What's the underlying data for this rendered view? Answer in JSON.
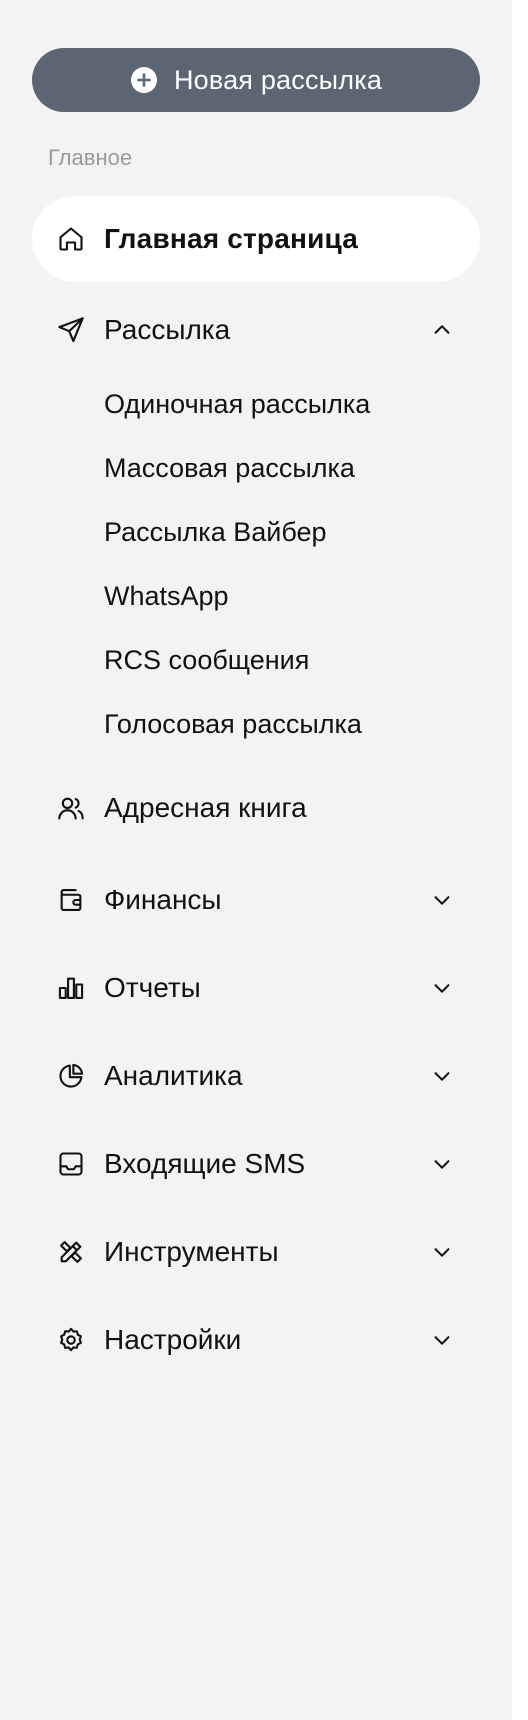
{
  "new_mailing_button": {
    "label": "Новая рассылка",
    "icon": "plus-circle-icon"
  },
  "section_label": "Главное",
  "nav": {
    "home": {
      "label": "Главная страница",
      "icon": "home-icon"
    },
    "mailing": {
      "label": "Рассылка",
      "icon": "send-icon",
      "expanded": true,
      "sub_items": [
        "Одиночная рассылка",
        "Массовая рассылка",
        "Рассылка Вайбер",
        "WhatsApp",
        "RCS сообщения",
        "Голосовая рассылка"
      ]
    },
    "address_book": {
      "label": "Адресная книга",
      "icon": "users-icon"
    },
    "finance": {
      "label": "Финансы",
      "icon": "wallet-icon"
    },
    "reports": {
      "label": "Отчеты",
      "icon": "bar-chart-icon"
    },
    "analytics": {
      "label": "Аналитика",
      "icon": "pie-chart-icon"
    },
    "incoming_sms": {
      "label": "Входящие SMS",
      "icon": "inbox-icon"
    },
    "tools": {
      "label": "Инструменты",
      "icon": "tools-icon"
    },
    "settings": {
      "label": "Настройки",
      "icon": "gear-icon"
    }
  },
  "colors": {
    "sidebar_bg": "#f3f3f3",
    "button_bg": "#5c6673",
    "active_bg": "#ffffff",
    "section_label": "#9a9a9a"
  }
}
